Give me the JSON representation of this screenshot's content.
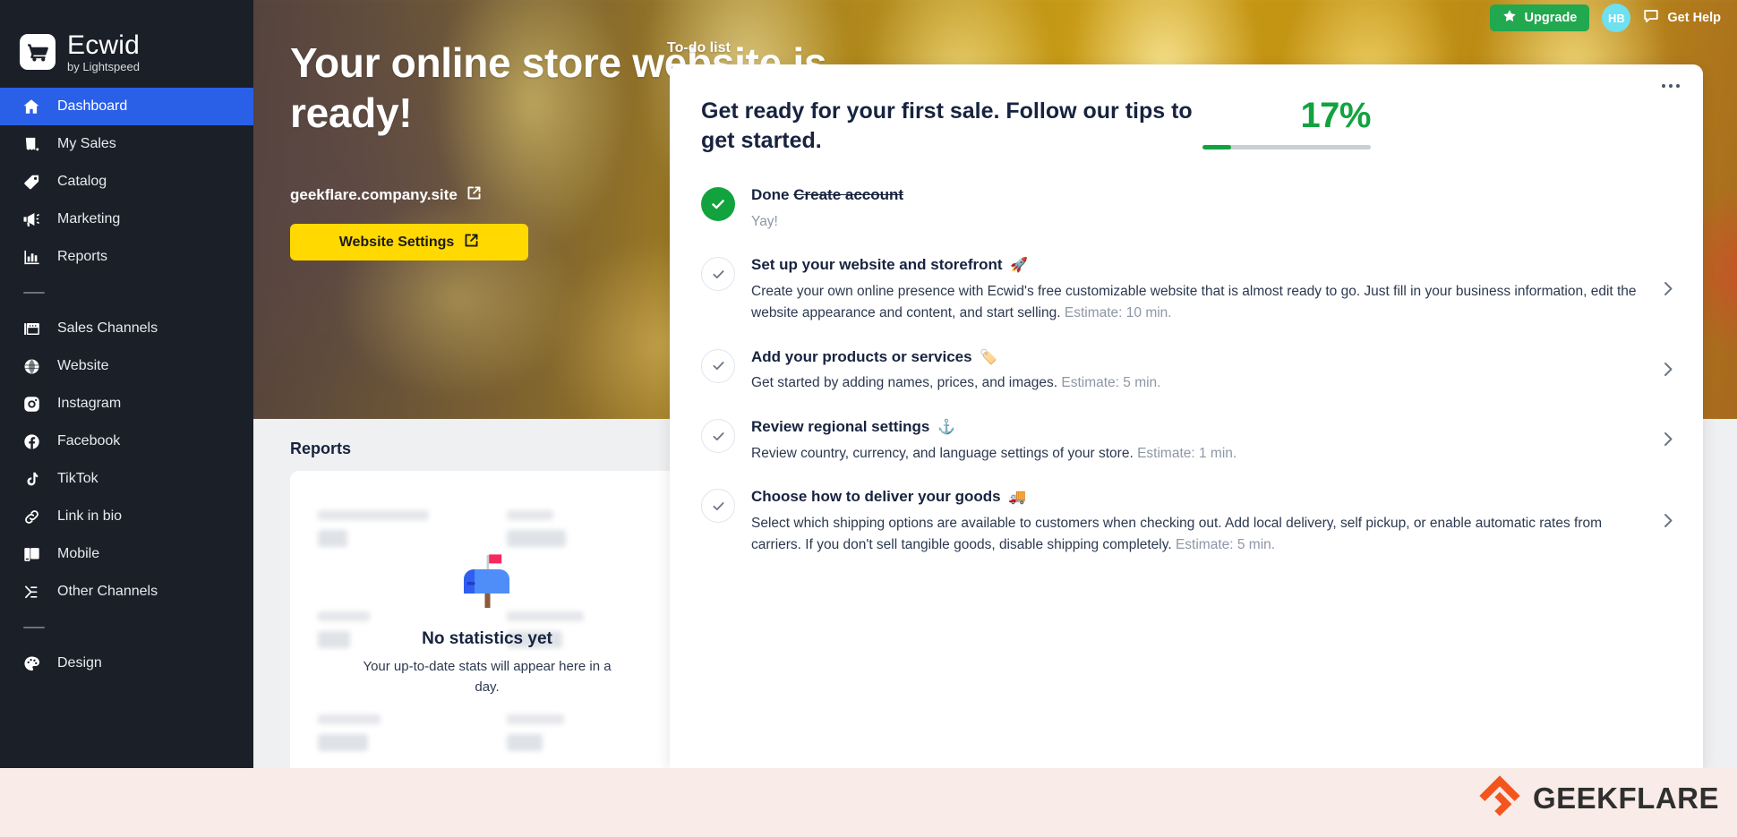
{
  "brand": {
    "name": "Ecwid",
    "tagline": "by Lightspeed",
    "logo_icon": "shopping-cart-icon"
  },
  "sidebar": {
    "items": [
      {
        "label": "Dashboard",
        "icon": "home-icon",
        "active": true
      },
      {
        "label": "My Sales",
        "icon": "receipt-icon",
        "active": false
      },
      {
        "label": "Catalog",
        "icon": "tag-icon",
        "active": false
      },
      {
        "label": "Marketing",
        "icon": "megaphone-icon",
        "active": false
      },
      {
        "label": "Reports",
        "icon": "bar-chart-icon",
        "active": false
      },
      {
        "label": "Sales Channels",
        "icon": "storefront-icon",
        "active": false
      },
      {
        "label": "Website",
        "icon": "globe-icon",
        "active": false
      },
      {
        "label": "Instagram",
        "icon": "instagram-icon",
        "active": false
      },
      {
        "label": "Facebook",
        "icon": "facebook-icon",
        "active": false
      },
      {
        "label": "TikTok",
        "icon": "tiktok-icon",
        "active": false
      },
      {
        "label": "Link in bio",
        "icon": "link-icon",
        "active": false
      },
      {
        "label": "Mobile",
        "icon": "mobile-icon",
        "active": false
      },
      {
        "label": "Other Channels",
        "icon": "share-nodes-icon",
        "active": false
      },
      {
        "label": "Design",
        "icon": "palette-icon",
        "active": false
      }
    ]
  },
  "topbar": {
    "upgrade_label": "Upgrade",
    "upgrade_icon": "star-icon",
    "avatar_initials": "HB",
    "help_label": "Get Help",
    "help_icon": "chat-bubble-icon"
  },
  "hero": {
    "title": "Your online store website is ready!",
    "url": "geekflare.company.site",
    "url_icon": "external-link-icon",
    "button_label": "Website Settings",
    "button_icon": "external-link-icon"
  },
  "todo": {
    "section_label": "To-do list",
    "heading": "Get ready for your first sale. Follow our tips to get started.",
    "progress_percent": "17%",
    "progress_value": 17,
    "menu_icon": "ellipsis-icon",
    "items": [
      {
        "state": "done",
        "prefix": "Done",
        "title": "Create account",
        "emoji": "",
        "desc": "Yay!",
        "estimate": "",
        "arrow": false
      },
      {
        "state": "todo",
        "prefix": "",
        "title": "Set up your website and storefront",
        "emoji": "🚀",
        "desc": "Create your own online presence with Ecwid's free customizable website that is almost ready to go. Just fill in your business information, edit the website appearance and content, and start selling.",
        "estimate": "Estimate: 10 min.",
        "arrow": true
      },
      {
        "state": "todo",
        "prefix": "",
        "title": "Add your products or services",
        "emoji": "🏷️",
        "desc": "Get started by adding names, prices, and images.",
        "estimate": "Estimate: 5 min.",
        "arrow": true
      },
      {
        "state": "todo",
        "prefix": "",
        "title": "Review regional settings",
        "emoji": "⚓",
        "desc": "Review country, currency, and language settings of your store.",
        "estimate": "Estimate: 1 min.",
        "arrow": true
      },
      {
        "state": "todo",
        "prefix": "",
        "title": "Choose how to deliver your goods",
        "emoji": "🚚",
        "desc": "Select which shipping options are available to customers when checking out. Add local delivery, self pickup, or enable automatic rates from carriers. If you don't sell tangible goods, disable shipping completely.",
        "estimate": "Estimate: 5 min.",
        "arrow": true
      }
    ]
  },
  "reports": {
    "title": "Reports",
    "empty_icon": "mailbox-icon",
    "empty_title": "No statistics yet",
    "empty_sub": "Your up-to-date stats will appear here in a day."
  },
  "watermark": {
    "text": "GEEKFLARE",
    "icon": "geekflare-logo-icon"
  },
  "colors": {
    "sidebar_bg": "#1b1f28",
    "sidebar_active": "#2a5fe8",
    "accent_yellow": "#ffd900",
    "success_green": "#12a33e",
    "upgrade_green": "#22a84f",
    "avatar_cyan": "#6fe0ef",
    "heading_navy": "#17233f",
    "muted_gray": "#8d97a6",
    "page_gray": "#eff0f1",
    "footer_pink": "#f9ebe7",
    "watermark_orange": "#f4551f"
  }
}
